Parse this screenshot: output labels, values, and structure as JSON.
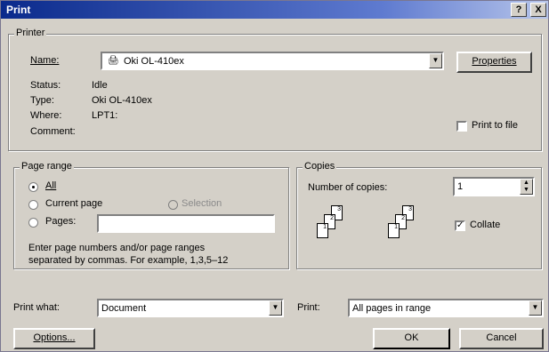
{
  "window": {
    "title": "Print",
    "help_button": "?",
    "close_button": "X"
  },
  "printer": {
    "group_label": "Printer",
    "name_label": "Name:",
    "name_value": "Oki OL-410ex",
    "properties_button": "Properties",
    "status_label": "Status:",
    "status_value": "Idle",
    "type_label": "Type:",
    "type_value": "Oki OL-410ex",
    "where_label": "Where:",
    "where_value": "LPT1:",
    "comment_label": "Comment:",
    "print_to_file_label": "Print to file"
  },
  "page_range": {
    "group_label": "Page range",
    "all_label": "All",
    "current_page_label": "Current page",
    "selection_label": "Selection",
    "pages_label": "Pages:",
    "pages_value": "",
    "hint_line1": "Enter page numbers and/or page ranges",
    "hint_line2": "separated by commas.  For example, 1,3,5–12"
  },
  "copies": {
    "group_label": "Copies",
    "number_label": "Number of copies:",
    "number_value": "1",
    "collate_label": "Collate",
    "collate_checked": true,
    "page_numbers": [
      "1",
      "2",
      "3"
    ]
  },
  "bottom": {
    "print_what_label": "Print what:",
    "print_what_value": "Document",
    "print_label": "Print:",
    "print_value": "All pages in range",
    "options_button": "Options...",
    "ok_button": "OK",
    "cancel_button": "Cancel"
  }
}
